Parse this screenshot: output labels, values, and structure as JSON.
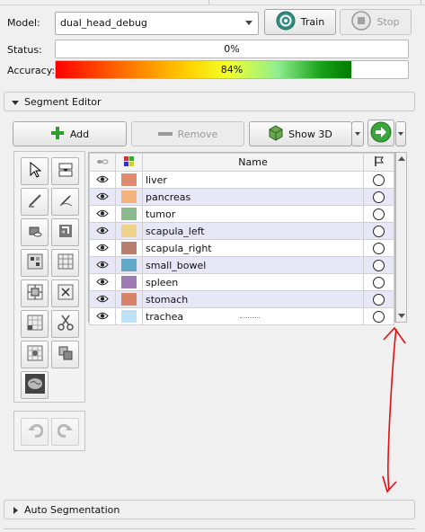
{
  "monai": {
    "model_label": "Model:",
    "model_value": "dual_head_debug",
    "train_label": "Train",
    "stop_label": "Stop",
    "status_label": "Status:",
    "status_value": "0%",
    "accuracy_label": "Accuracy:",
    "accuracy_value": "84%",
    "accuracy_fraction": 0.84
  },
  "segment_editor": {
    "title": "Segment Editor",
    "add_label": "Add",
    "remove_label": "Remove",
    "show3d_label": "Show 3D",
    "columns": {
      "name": "Name"
    },
    "segments": [
      {
        "name": "liver",
        "color": "#e08a6e"
      },
      {
        "name": "pancreas",
        "color": "#f4b179"
      },
      {
        "name": "tumor",
        "color": "#8cb98e"
      },
      {
        "name": "scapula_left",
        "color": "#f0d38b"
      },
      {
        "name": "scapula_right",
        "color": "#b97f6e"
      },
      {
        "name": "small_bowel",
        "color": "#5fa8c7"
      },
      {
        "name": "spleen",
        "color": "#a07ab5"
      },
      {
        "name": "stomach",
        "color": "#d9826a"
      },
      {
        "name": "trachea",
        "color": "#bfe1f7"
      }
    ]
  },
  "auto_segmentation": {
    "title": "Auto Segmentation"
  },
  "annotation": {
    "color": "#e01010"
  }
}
